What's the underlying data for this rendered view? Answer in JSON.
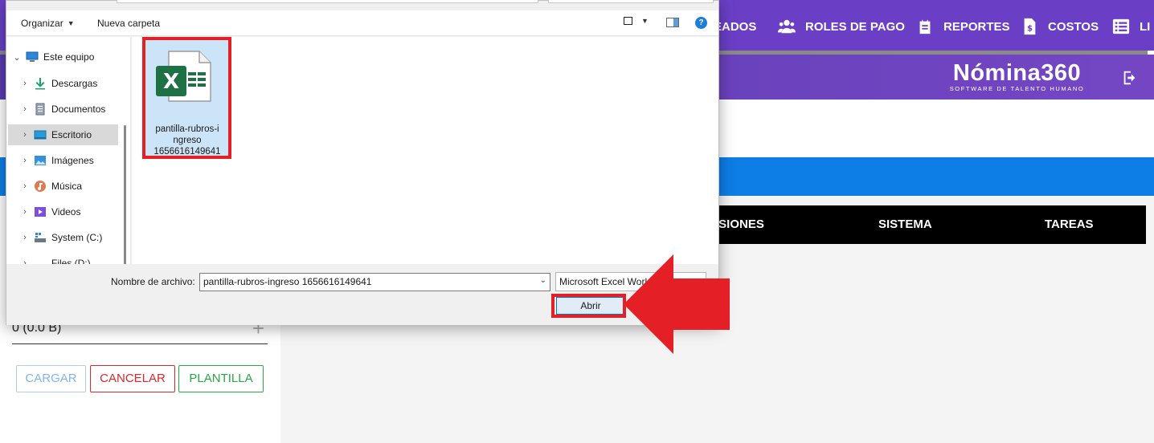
{
  "app": {
    "nav": [
      {
        "id": "empleados",
        "label": "EADOS",
        "icon": "users-icon"
      },
      {
        "id": "roles",
        "label": "ROLES DE PAGO",
        "icon": "users-group-icon"
      },
      {
        "id": "reportes",
        "label": "REPORTES",
        "icon": "clipboard-icon"
      },
      {
        "id": "costos",
        "label": "COSTOS",
        "icon": "dollar-document-icon"
      },
      {
        "id": "li",
        "label": "LI",
        "icon": "list-icon"
      }
    ],
    "brand": {
      "name": "Nómina360",
      "tagline": "SOFTWARE DE TALENTO HUMANO"
    },
    "menu": {
      "m1": "ISIONES",
      "m2": "SISTEMA",
      "m3": "TAREAS"
    },
    "upload": {
      "size_text": "0 (0.0 B)",
      "plus": "+"
    },
    "buttons": {
      "cargar": "CARGAR",
      "cancelar": "CANCELAR",
      "plantilla": "PLANTILLA"
    },
    "colors": {
      "nav": "#6a3fc6",
      "blue": "#0d7ee6",
      "red": "#e41f26",
      "green": "#2aa745"
    }
  },
  "dialog": {
    "toolbar": {
      "organize": "Organizar",
      "new_folder": "Nueva carpeta",
      "help": "?"
    },
    "nav": [
      {
        "label": "Este equipo",
        "icon": "computer-icon"
      },
      {
        "label": "Descargas",
        "icon": "download-icon"
      },
      {
        "label": "Documentos",
        "icon": "documents-icon"
      },
      {
        "label": "Escritorio",
        "icon": "desktop-icon"
      },
      {
        "label": "Imágenes",
        "icon": "images-icon"
      },
      {
        "label": "Música",
        "icon": "music-icon"
      },
      {
        "label": "Videos",
        "icon": "videos-icon"
      },
      {
        "label": "System (C:)",
        "icon": "drive-icon"
      },
      {
        "label": "Files (D:)",
        "icon": "drive-icon"
      }
    ],
    "file": {
      "line1": "pantilla-rubros-i",
      "line2": "ngreso",
      "line3": "1656616149641",
      "icon": "excel-file-icon"
    },
    "filename_label": "Nombre de archivo:",
    "filename_value": "pantilla-rubros-ingreso 1656616149641",
    "filetype": "Microsoft Excel Worksheet",
    "open_label": "Abrir"
  }
}
